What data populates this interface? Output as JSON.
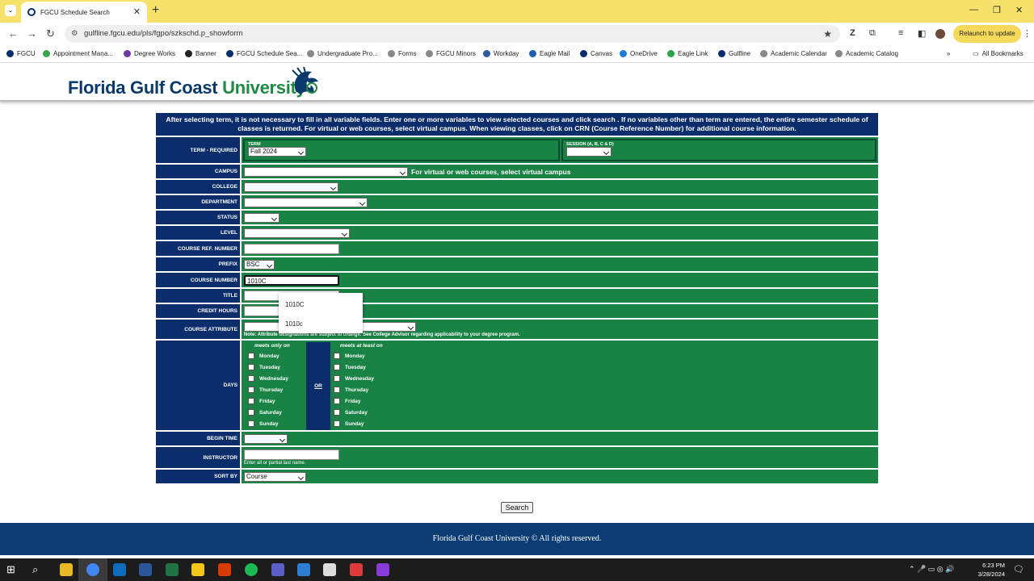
{
  "browser": {
    "tab_title": "FGCU Schedule Search",
    "url": "gulfline.fgcu.edu/pls/fgpo/szkschd.p_showform",
    "relaunch_label": "Relaunch to update",
    "bookmarks": [
      "FGCU",
      "Appointment Mana...",
      "Degree Works",
      "Banner",
      "FGCU Schedule Sea...",
      "Undergraduate Pro...",
      "Forms",
      "FGCU Minors",
      "Workday",
      "Eagle Mail",
      "Canvas",
      "OneDrive",
      "Eagle Link",
      "Gulfline",
      "Academic Calendar",
      "Academic Catalog"
    ],
    "all_bookmarks": "All Bookmarks"
  },
  "header": {
    "logo_part1": "Florida Gulf Coast ",
    "logo_part2": "University"
  },
  "form": {
    "intro": "After selecting term, it is not necessary to fill in all variable fields. Enter one or more variables to view selected courses and click search . If no variables other than term are entered, the entire semester schedule of classes is returned. For virtual or web courses, select virtual campus. When viewing classes, click on CRN (Course Reference Number) for additional course information.",
    "term_label": "TERM - REQUIRED",
    "term_sub": "TERM",
    "term_value": "Fall 2024",
    "session_sub": "SESSION (A, B, C & D)",
    "session_value": "",
    "campus_label": "CAMPUS",
    "campus_hint": "For virtual or web courses, select virtual campus",
    "college_label": "COLLEGE",
    "department_label": "DEPARTMENT",
    "status_label": "STATUS",
    "level_label": "LEVEL",
    "crn_label": "COURSE REF. NUMBER",
    "crn_value": "",
    "prefix_label": "PREFIX",
    "prefix_value": "BSC",
    "course_number_label": "COURSE NUMBER",
    "course_number_value": "1010C",
    "title_label": "TITLE",
    "credit_hours_label": "CREDIT HOURS",
    "attribute_label": "COURSE ATTRIBUTE",
    "attribute_note": "Note: Attribute designations are subject to change. See College Advisor regarding applicability to your degree program.",
    "days_label": "DAYS",
    "meets_only": "meets only on",
    "meets_least": "meets at least on",
    "or_label": "OR",
    "days": [
      "Monday",
      "Tuesday",
      "Wednesday",
      "Thursday",
      "Friday",
      "Saturday",
      "Sunday"
    ],
    "begin_time_label": "BEGIN TIME",
    "instructor_label": "INSTRUCTOR",
    "instructor_note": "Enter all or partial last name.",
    "sort_label": "SORT BY",
    "sort_value": "Course",
    "search_button": "Search"
  },
  "autocomplete": [
    "1010C",
    "1010c"
  ],
  "footer": "Florida Gulf Coast University © All rights reserved.",
  "taskbar": {
    "time": "6:23 PM",
    "date": "3/28/2024"
  },
  "colors": {
    "navy": "#0b2d6b",
    "green": "#198245",
    "tab_yellow": "#f6e16a"
  }
}
